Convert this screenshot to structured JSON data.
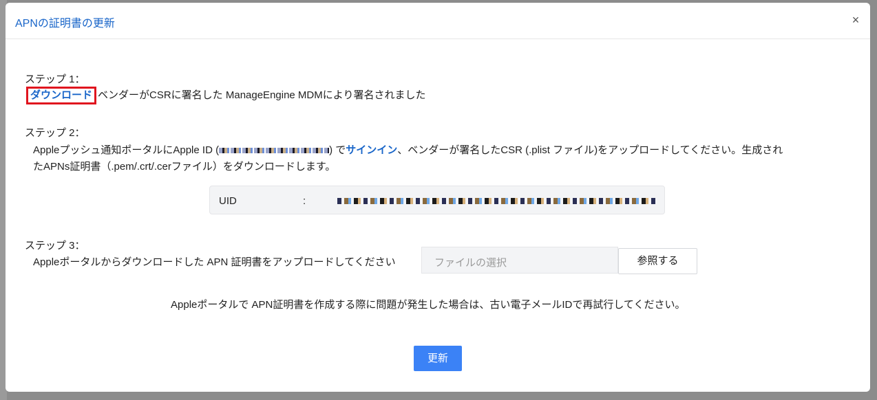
{
  "dialog": {
    "title": "APNの証明書の更新",
    "close_icon": "×"
  },
  "step1": {
    "label": "ステップ 1：",
    "download_link": "ダウンロード",
    "text": "ベンダーがCSRに署名した ManageEngine MDMにより署名されました"
  },
  "step2": {
    "label": "ステップ 2：",
    "text_before": "Appleプッシュ通知ポータルにApple ID (",
    "text_after_id": ") で",
    "signin_link": "サインイン",
    "text_rest": "、ベンダーが署名したCSR (.plist ファイル)をアップロードしてください。生成され",
    "text_line2": "たAPNs証明書（.pem/.crt/.cerファイル）をダウンロードします。",
    "uid_label": "UID",
    "uid_separator": ":"
  },
  "step3": {
    "label": "ステップ 3：",
    "text": "Appleポータルからダウンロードした APN 証明書をアップロードしてください",
    "file_placeholder": "ファイルの選択",
    "browse_button": "参照する"
  },
  "note": "Appleポータルで APN証明書を作成する際に問題が発生した場合は、古い電子メールIDで再試行してください。",
  "update_button": "更新",
  "colors": {
    "link": "#1a66c9",
    "primary_button": "#3b82f6",
    "highlight_box": "#e0141e"
  }
}
